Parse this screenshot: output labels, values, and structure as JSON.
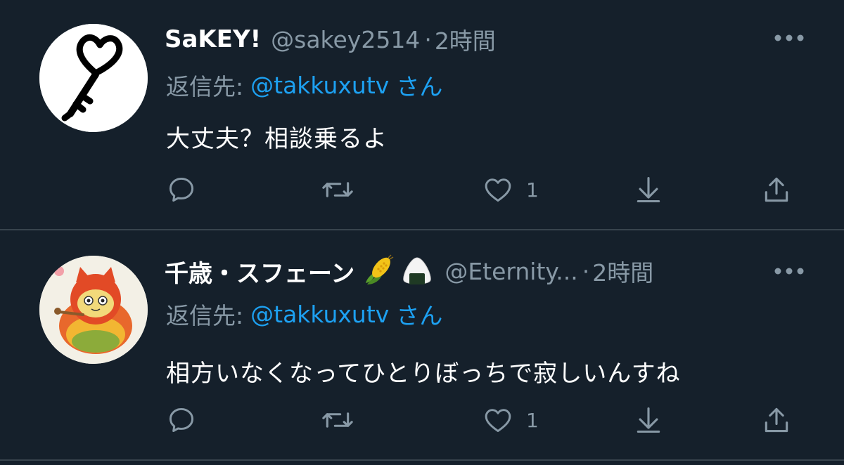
{
  "tweets": [
    {
      "name": "SaKEY!",
      "handle": "@sakey2514",
      "separator": "·",
      "time": "2時間",
      "reply_prefix": "返信先:",
      "reply_mention": "@takkuxutv",
      "reply_suffix": "さん",
      "text": "大丈夫？相談乗るよ",
      "like_count": "1",
      "name_emojis": []
    },
    {
      "name": "千歳・スフェーン",
      "handle": "@Eternity...",
      "separator": "·",
      "time": "2時間",
      "reply_prefix": "返信先:",
      "reply_mention": "@takkuxutv",
      "reply_suffix": "さん",
      "text": "相方いなくなってひとりぼっちで寂しいんすね",
      "like_count": "1",
      "name_emojis": [
        "corn-emoji",
        "onigiri-emoji"
      ]
    }
  ],
  "colors": {
    "background": "#15202b",
    "divider": "#38444d",
    "secondary_text": "#8899a6",
    "link": "#1da1f2",
    "primary_text": "#ffffff"
  },
  "icons": {
    "more": "more-horizontal-icon",
    "reply": "reply-bubble-icon",
    "retweet": "retweet-icon",
    "like": "heart-icon",
    "download": "download-icon",
    "share": "share-icon"
  }
}
